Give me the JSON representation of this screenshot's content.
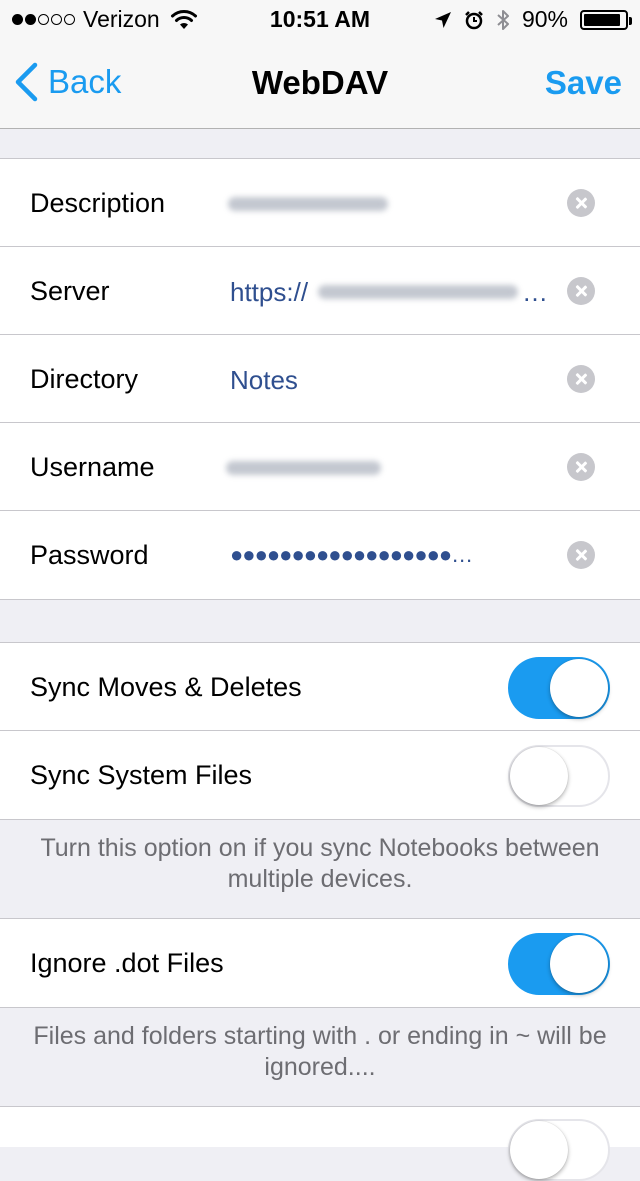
{
  "status_bar": {
    "carrier": "Verizon",
    "time": "10:51 AM",
    "battery": "90%",
    "battery_level": 0.9
  },
  "nav": {
    "back_label": "Back",
    "title": "WebDAV",
    "save_label": "Save"
  },
  "account": {
    "description_label": "Description",
    "server_label": "Server",
    "server_value": "https://",
    "directory_label": "Directory",
    "directory_value": "Notes",
    "username_label": "Username",
    "password_label": "Password",
    "password_value": "●●●●●●●●●●●●●●●●●●…"
  },
  "options": {
    "sync_moves_label": "Sync Moves & Deletes",
    "sync_moves_on": true,
    "sync_system_label": "Sync System Files",
    "sync_system_on": false,
    "sync_note": "Turn this option on if you sync Notebooks between multiple devices.",
    "ignore_dot_label": "Ignore .dot Files",
    "ignore_dot_on": true,
    "ignore_note": "Files and folders starting with . or ending in ~ will be ignored...."
  },
  "colors": {
    "accent": "#1a9bf0",
    "value_text": "#2f4f8f",
    "background": "#efeff4"
  }
}
